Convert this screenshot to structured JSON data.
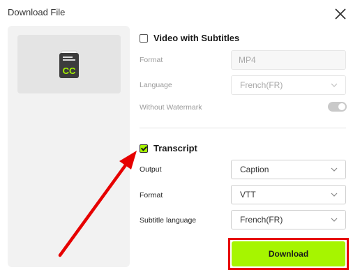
{
  "dialog": {
    "title": "Download File",
    "close_icon": "close-icon"
  },
  "preview": {
    "icon": "closed-captions-icon",
    "badge_text": "CC"
  },
  "video": {
    "checkbox_label": "Video with Subtitles",
    "checked": false,
    "format_label": "Format",
    "format_value": "MP4",
    "language_label": "Language",
    "language_value": "French(FR)",
    "watermark_label": "Without Watermark",
    "watermark_on": true
  },
  "transcript": {
    "checkbox_label": "Transcript",
    "checked": true,
    "output_label": "Output",
    "output_value": "Caption",
    "format_label": "Format",
    "format_value": "VTT",
    "subtitle_language_label": "Subtitle language",
    "subtitle_language_value": "French(FR)"
  },
  "actions": {
    "download_label": "Download"
  },
  "colors": {
    "accent": "#a6f500",
    "highlight": "#e60000"
  }
}
